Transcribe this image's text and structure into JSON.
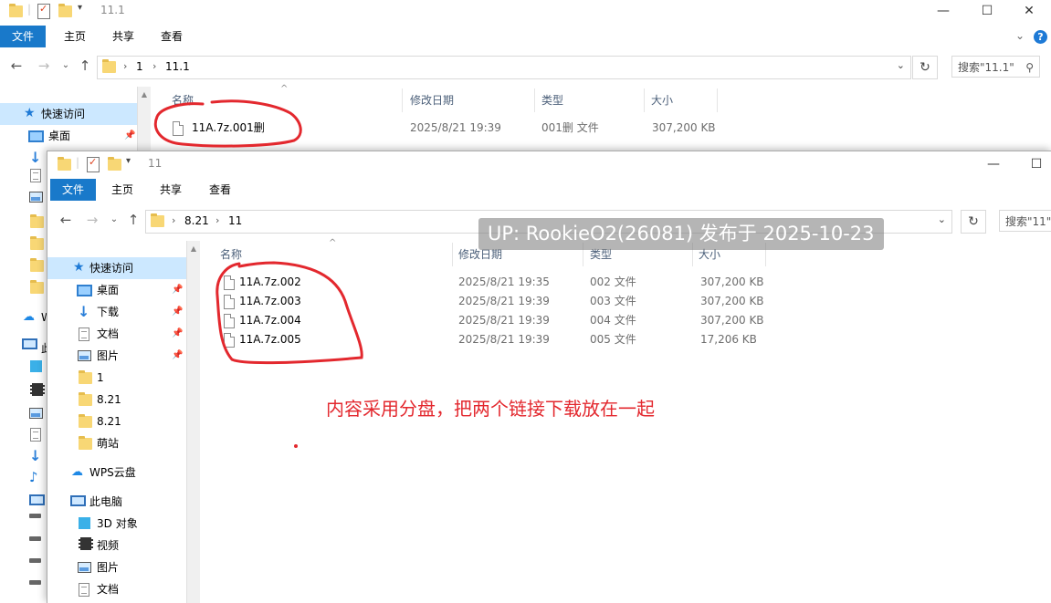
{
  "back_window": {
    "title": "11.1",
    "ribbon_tabs": [
      "文件",
      "主页",
      "共享",
      "查看"
    ],
    "breadcrumb": [
      "1",
      "11.1"
    ],
    "search_placeholder": "搜索\"11.1\"",
    "columns": [
      "名称",
      "修改日期",
      "类型",
      "大小"
    ],
    "nav": {
      "quick_access": "快速访问",
      "items": [
        {
          "label": "桌面",
          "icon": "desktop-icon"
        }
      ]
    },
    "files": [
      {
        "name": "11A.7z.001删",
        "date": "2025/8/21 19:39",
        "type": "001删 文件",
        "size": "307,200 KB"
      }
    ],
    "nav_truncated": [
      "W",
      "此"
    ]
  },
  "front_window": {
    "title": "11",
    "ribbon_tabs": [
      "文件",
      "主页",
      "共享",
      "查看"
    ],
    "breadcrumb": [
      "8.21",
      "11"
    ],
    "search_placeholder": "搜索\"11\"",
    "columns": [
      "名称",
      "修改日期",
      "类型",
      "大小"
    ],
    "nav": {
      "quick_access": "快速访问",
      "pinned": [
        {
          "label": "桌面",
          "icon": "desktop-icon"
        },
        {
          "label": "下载",
          "icon": "download-icon"
        },
        {
          "label": "文档",
          "icon": "document-icon"
        },
        {
          "label": "图片",
          "icon": "pictures-icon"
        }
      ],
      "folders": [
        {
          "label": "1"
        },
        {
          "label": "8.21"
        },
        {
          "label": "8.21"
        },
        {
          "label": "萌站"
        }
      ],
      "wps": "WPS云盘",
      "this_pc": "此电脑",
      "pc_items": [
        {
          "label": "3D 对象",
          "icon": "3d-objects-icon"
        },
        {
          "label": "视频",
          "icon": "video-icon"
        },
        {
          "label": "图片",
          "icon": "pictures-icon"
        },
        {
          "label": "文档",
          "icon": "document-icon"
        }
      ]
    },
    "files": [
      {
        "name": "11A.7z.002",
        "date": "2025/8/21 19:35",
        "type": "002 文件",
        "size": "307,200 KB"
      },
      {
        "name": "11A.7z.003",
        "date": "2025/8/21 19:39",
        "type": "003 文件",
        "size": "307,200 KB"
      },
      {
        "name": "11A.7z.004",
        "date": "2025/8/21 19:39",
        "type": "004 文件",
        "size": "307,200 KB"
      },
      {
        "name": "11A.7z.005",
        "date": "2025/8/21 19:39",
        "type": "005 文件",
        "size": "17,206 KB"
      }
    ]
  },
  "overlay": {
    "watermark": "UP: RookieO2(26081) 发布于 2025-10-23",
    "annotation": "内容采用分盘，把两个链接下载放在一起",
    "ink_color": "#e3282e"
  }
}
